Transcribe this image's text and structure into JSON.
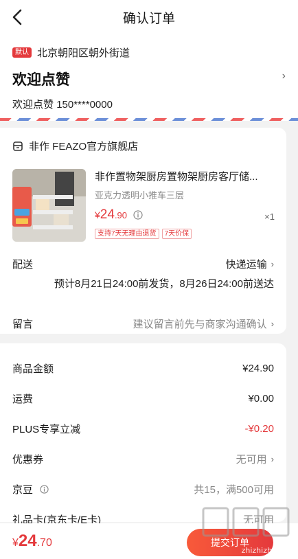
{
  "header": {
    "title": "确认订单"
  },
  "address": {
    "default_badge": "默认",
    "region": "北京朝阳区朝外街道",
    "name": "欢迎点赞",
    "contact_name": "欢迎点赞",
    "phone": "150****0000"
  },
  "shop": {
    "name": "非作 FEAZO官方旗舰店",
    "product": {
      "title": "非作置物架厨房置物架厨房客厅储...",
      "spec": "亚克力透明小推车三层",
      "price_yen": "¥",
      "price_int": "24",
      "price_dec": ".90",
      "quantity": "×1",
      "tags": [
        "支持7天无理由退货",
        "7天价保"
      ]
    },
    "delivery": {
      "label": "配送",
      "method": "快递运输",
      "note": "预计8月21日24:00前发货，8月26日24:00前送达"
    },
    "message": {
      "label": "留言",
      "placeholder": "建议留言前先与商家沟通确认"
    }
  },
  "fees": {
    "goods_label": "商品金额",
    "goods_value": "¥24.90",
    "shipping_label": "运费",
    "shipping_value": "¥0.00",
    "plus_label": "PLUS专享立减",
    "plus_value": "-¥0.20",
    "coupon_label": "优惠券",
    "coupon_value": "无可用",
    "jingdou_label": "京豆",
    "jingdou_value": "共15，满500可用",
    "giftcard_label": "礼品卡(京东卡/E卡)",
    "giftcard_value": "无可用"
  },
  "bottom": {
    "total_yen": "¥",
    "total_int": "24",
    "total_dec": ".70",
    "submit_label": "提交订单",
    "watermark": "zhizhizhi.com"
  },
  "colors": {
    "accent": "#e4393c",
    "background": "#f2f2f2"
  }
}
